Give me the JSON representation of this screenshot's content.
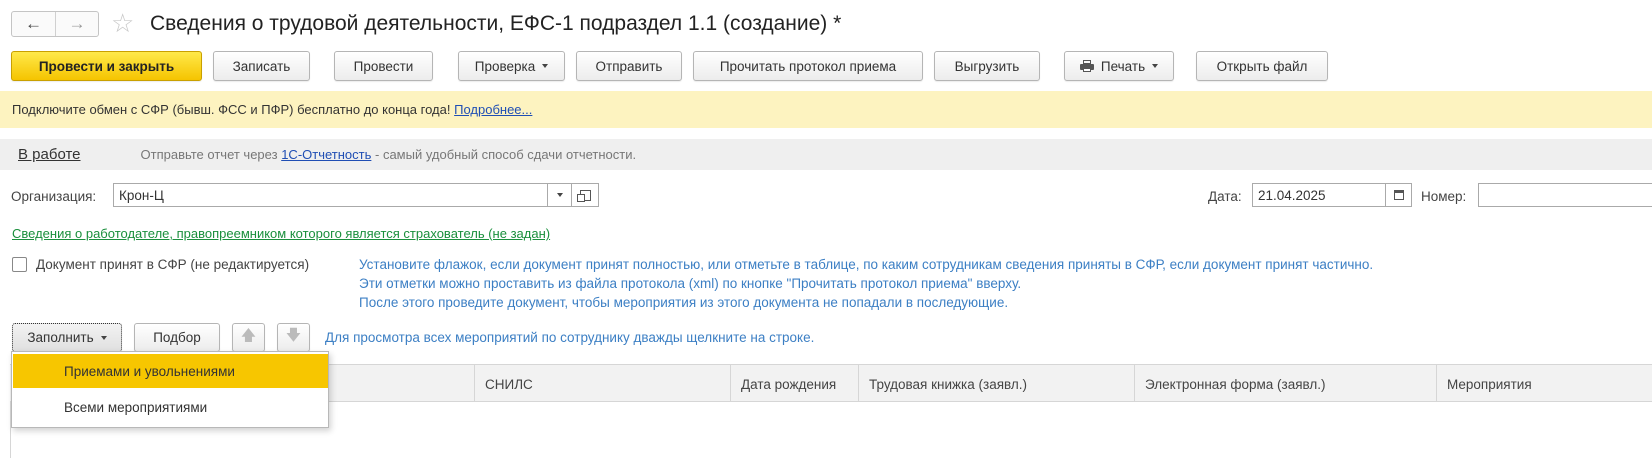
{
  "titlebar": {
    "back_icon": "arrow-left-icon",
    "forward_icon": "arrow-right-icon",
    "star_icon": "star-outline-icon",
    "title": "Сведения о трудовой деятельности, ЕФС-1 подраздел 1.1 (создание) *"
  },
  "toolbar": {
    "post_close": "Провести и закрыть",
    "save": "Записать",
    "post": "Провести",
    "check": "Проверка",
    "send": "Отправить",
    "read_protocol": "Прочитать протокол приема",
    "export": "Выгрузить",
    "print": "Печать",
    "print_icon": "printer-icon",
    "open_file": "Открыть файл"
  },
  "banner": {
    "text": "Подключите обмен с СФР (бывш. ФСС и ПФР) бесплатно до конца года!",
    "link": "Подробнее..."
  },
  "status": {
    "state": "В работе",
    "text_before": "Отправьте отчет через",
    "link": "1С-Отчетность",
    "text_after": "- самый удобный способ сдачи отчетности."
  },
  "form": {
    "org_label": "Организация:",
    "org_value": "Крон-Ц",
    "date_label": "Дата:",
    "date_value": "21.04.2025",
    "number_label": "Номер:",
    "number_value": ""
  },
  "successor_link": "Сведения о работодателе, правопреемником которого является страхователь (не задан)",
  "accepted": {
    "label": "Документ принят в СФР (не редактируется)",
    "checked": false,
    "hint_lines": [
      "Установите флажок, если документ принят полностью, или отметьте в таблице, по каким сотрудникам сведения приняты в СФР, если документ принят частично.",
      "Эти отметки можно проставить из файла протокола (xml) по кнопке \"Прочитать протокол приема\" вверху.",
      "После этого проведите документ, чтобы мероприятия из этого документа не попадали в последующие."
    ]
  },
  "table_toolbar": {
    "fill": "Заполнить",
    "select": "Подбор",
    "up_icon": "arrow-up-icon",
    "down_icon": "arrow-down-icon",
    "hint": "Для просмотра всех мероприятий по сотруднику дважды щелкните на строке."
  },
  "table": {
    "columns": [
      "СНИЛС",
      "Дата рождения",
      "Трудовая книжка (заявл.)",
      "Электронная форма (заявл.)",
      "Мероприятия"
    ]
  },
  "dropdown": {
    "items": [
      "Приемами и увольнениями",
      "Всеми мероприятиями"
    ],
    "highlighted_index": 0
  },
  "colors": {
    "accent_yellow": "#f7c600",
    "banner_bg": "#fdf3c0",
    "link_blue": "#1f4eb4",
    "hint_blue": "#3c7fc4",
    "green_link": "#1a8f3c"
  }
}
